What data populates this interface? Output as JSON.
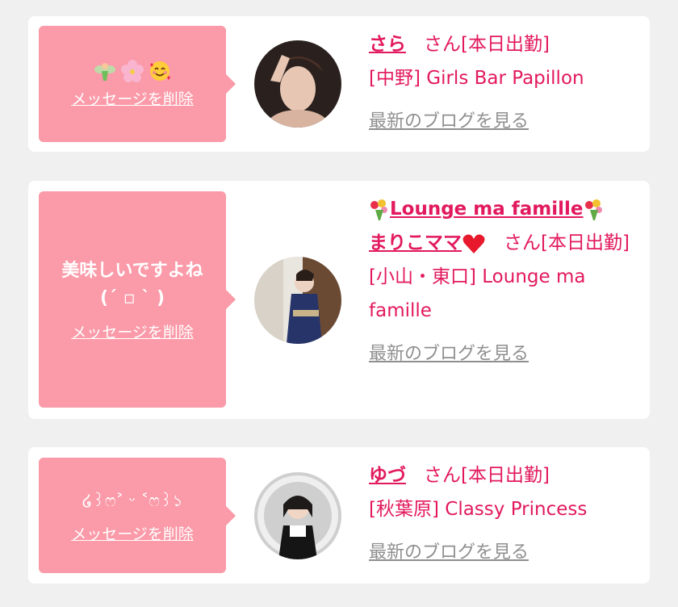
{
  "messages": [
    {
      "message_text": "",
      "emoji_icons": [
        "fairy-icon",
        "cherry-blossom-icon",
        "smiling-hearts-face-icon"
      ],
      "delete_label": "メッセージを削除",
      "cast_name": "さら",
      "honorific": "さん",
      "status": "[本日出勤]",
      "shop": "[中野] Girls Bar Papillon",
      "blog_label": "最新のブログを見る"
    },
    {
      "message_text": "美味しいですよね\n(´ ▫ ` )",
      "delete_label": "メッセージを削除",
      "shop_title": "Lounge ma famille",
      "cast_name": "まりこママ",
      "honorific": "さん",
      "status": "[本日出勤]",
      "shop": "[小山・東口] Lounge ma famille",
      "blog_label": "最新のブログを見る"
    },
    {
      "message_text": "໒꒱ෆ˃ ᵕ ˂ෆ꒱১",
      "delete_label": "メッセージを削除",
      "cast_name": "ゆづ",
      "honorific": "さん",
      "status": "[本日出勤]",
      "shop": "[秋葉原] Classy Princess",
      "blog_label": "最新のブログを見る"
    }
  ],
  "colors": {
    "background": "#f0f0f0",
    "card": "#ffffff",
    "bubble": "#fb9aa8",
    "accent_pink": "#e2195e",
    "link_gray": "#8f8f8f"
  }
}
